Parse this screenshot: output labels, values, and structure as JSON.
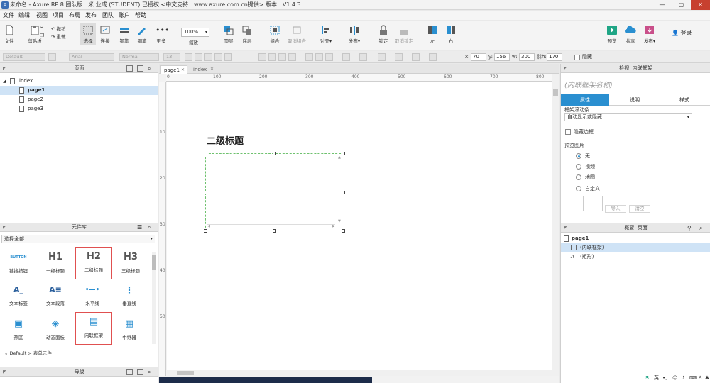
{
  "window": {
    "title": "未命名 - Axure RP 8 团队版 : 米 业成 (STUDENT) 已授权   <中文支持 : www.axure.com.cn提供> 版本 : V1.4.3",
    "app_icon": "axure-icon",
    "controls": {
      "minimize": "—",
      "maximize": "▢",
      "close": "✕"
    }
  },
  "menu": [
    "文件",
    "编辑",
    "视图",
    "项目",
    "布局",
    "发布",
    "团队",
    "账户",
    "帮助"
  ],
  "toolbar": {
    "file": "文件",
    "clipboard": "剪贴板",
    "cut": "剪切",
    "copy": "复制",
    "undo": "撤销",
    "redo": "重做",
    "select": "选择",
    "connect": "连接",
    "pen": "钢笔",
    "more": "更多",
    "zoom_value": "100%",
    "zoom_label": "缩放",
    "top": "顶层",
    "bottom": "底层",
    "group": "组合",
    "ungroup": "取消组合",
    "align": "对齐",
    "distribute": "分布",
    "lock": "锁定",
    "unlock": "取消锁定",
    "left": "左",
    "right": "右",
    "preview": "预览",
    "share": "共享",
    "publish": "发布",
    "login": "登录"
  },
  "format": {
    "style": "Default",
    "font": "Arial",
    "weight": "Normal",
    "size": "13",
    "x_label": "x:",
    "x": "70",
    "y_label": "y:",
    "y": "156",
    "w_label": "w:",
    "w": "300",
    "h_label": "h:",
    "h": "170",
    "hidden_label": "隐藏"
  },
  "pages_panel": {
    "title": "页面",
    "root": "index",
    "pages": [
      "page1",
      "page2",
      "page3"
    ],
    "selected": "page1"
  },
  "library_panel": {
    "title": "元件库",
    "select_value": "选择全部",
    "items": [
      {
        "icon": "BUTTON",
        "label": "链接按钮"
      },
      {
        "icon": "H1",
        "label": "一级标题"
      },
      {
        "icon": "H2",
        "label": "二级标题"
      },
      {
        "icon": "H3",
        "label": "三级标题"
      },
      {
        "icon": "A_",
        "label": "文本标签"
      },
      {
        "icon": "A≡",
        "label": "文本段落"
      },
      {
        "icon": "•—•",
        "label": "水平线"
      },
      {
        "icon": "⋮",
        "label": "垂直线"
      },
      {
        "icon": "▣",
        "label": "热区"
      },
      {
        "icon": "◈",
        "label": "动态面板"
      },
      {
        "icon": "▤",
        "label": "内联框架"
      },
      {
        "icon": "▦",
        "label": "中继器"
      }
    ],
    "footer": "Default > 表单元件",
    "master_title": "母版"
  },
  "canvas": {
    "tabs": [
      "page1",
      "index"
    ],
    "active_tab": "page1",
    "ruler_h": [
      "0",
      "100",
      "200",
      "300",
      "400",
      "500",
      "600",
      "700",
      "800"
    ],
    "ruler_v": [
      "100",
      "200",
      "300",
      "400",
      "500"
    ],
    "heading_text": "二级标题"
  },
  "inspector": {
    "title": "检视: 内联框架",
    "name_placeholder": "(内联框架名称)",
    "tabs": [
      "属性",
      "说明",
      "样式"
    ],
    "active_tab": "属性",
    "scrollbar_label": "框架滚动条",
    "scrollbar_value": "自动显示或隐藏",
    "hide_border": "隐藏边框",
    "preview_label": "预览图片",
    "preview_options": [
      "无",
      "视频",
      "地图",
      "自定义"
    ],
    "preview_selected": "无",
    "import_btn": "导入",
    "clear_btn": "清空"
  },
  "outline": {
    "title": "概要: 页面",
    "page": "page1",
    "items": [
      {
        "icon": "inline-frame-icon",
        "label": "(内联框架)",
        "selected": true
      },
      {
        "icon": "text-icon",
        "label": "(矩形)",
        "selected": false
      }
    ]
  },
  "tray": {
    "ime": "英"
  },
  "colors": {
    "accent": "#2a8fd0",
    "selection": "#cfe3f6",
    "highlight": "#e05050",
    "frame_border": "#6ec16e"
  }
}
